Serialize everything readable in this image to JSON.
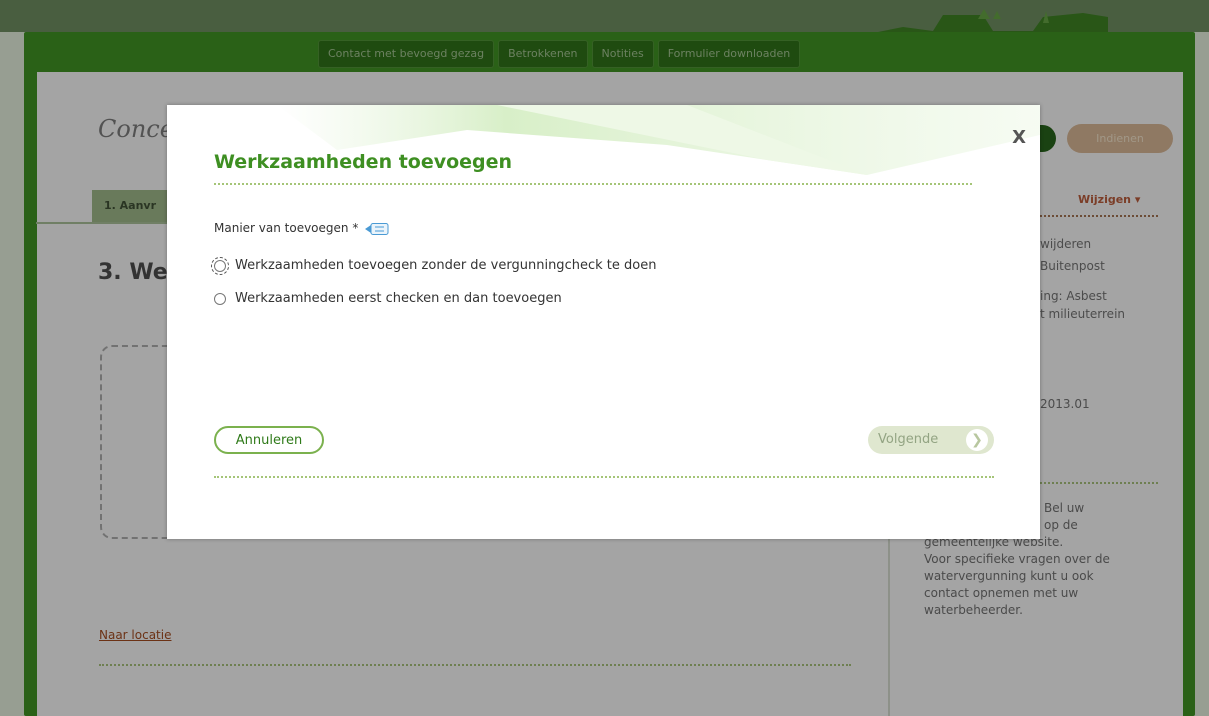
{
  "nav": {
    "tabs": [
      "Contact met bevoegd gezag",
      "Betrokkenen",
      "Notities",
      "Formulier downloaden"
    ]
  },
  "background": {
    "title_partial": "Conce",
    "step_tab": "1. Aanvr",
    "section_heading": "3. We",
    "link_naar_locatie": "Naar locatie",
    "indienen_button": "Indienen",
    "wijzigen": "Wijzigen ▾",
    "side_lines": [
      "wijderen",
      "Buitenpost",
      "ing: Asbest",
      "t milieuterrein",
      "2013.01"
    ],
    "help_text_lines": [
      "Bel uw",
      "op de",
      "gemeentelijke website.",
      "Voor specifieke vragen over de",
      "watervergunning kunt u ook",
      "contact opnemen met uw",
      "waterbeheerder."
    ]
  },
  "modal": {
    "title": "Werkzaamheden toevoegen",
    "close_label": "X",
    "field_label": "Manier van toevoegen *",
    "options": [
      {
        "label": "Werkzaamheden toevoegen zonder de vergunningcheck te doen",
        "selected": false,
        "focused": true
      },
      {
        "label": "Werkzaamheden eerst checken en dan toevoegen",
        "selected": false,
        "focused": false
      }
    ],
    "cancel_label": "Annuleren",
    "next_label": "Volgende",
    "next_icon": "chevron-right-icon"
  },
  "colors": {
    "brand_green": "#3e8f22",
    "link_orange": "#a04b20"
  }
}
